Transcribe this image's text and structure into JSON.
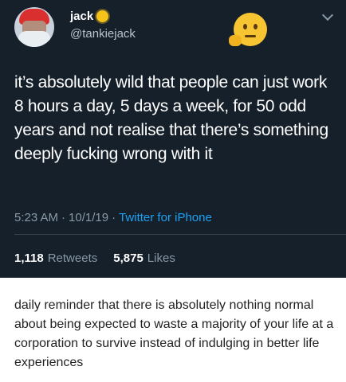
{
  "tweet": {
    "display_name": "jack",
    "handle": "@tankiejack",
    "text": "it’s absolutely wild that people can just work 8 hours a day, 5 days a week, for 50 odd years and not realise that there’s something deeply fucking wrong with it",
    "time": "5:23 AM",
    "date": "10/1/19",
    "separator": "·",
    "source": "Twitter for iPhone",
    "retweets_count": "1,118",
    "retweets_label": "Retweets",
    "likes_count": "5,875",
    "likes_label": "Likes",
    "icons": [
      "sun-icon",
      "thinking-face-icon",
      "chevron-down-icon"
    ],
    "colors": {
      "background": "#15202b",
      "link": "#1da1f2",
      "muted": "#8899a6"
    }
  },
  "caption": {
    "text": "daily reminder that there is absolutely nothing normal about being expected to waste a majority of your life at a corporation to survive instead of indulging in better life experiences"
  }
}
